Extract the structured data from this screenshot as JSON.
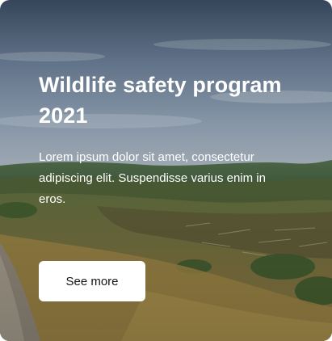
{
  "card": {
    "image": {
      "subject": "landscape-photo",
      "sky_color": "#7d8ea3",
      "grass_color": "#8a7a45"
    },
    "title": "Wildlife safety program 2021",
    "body": "Lorem ipsum dolor sit amet, consectetur adipiscing elit. Suspendisse varius enim in eros.",
    "button_label": "See more",
    "colors": {
      "text": "#ffffff",
      "button_bg": "#ffffff",
      "button_text": "#151515"
    }
  }
}
